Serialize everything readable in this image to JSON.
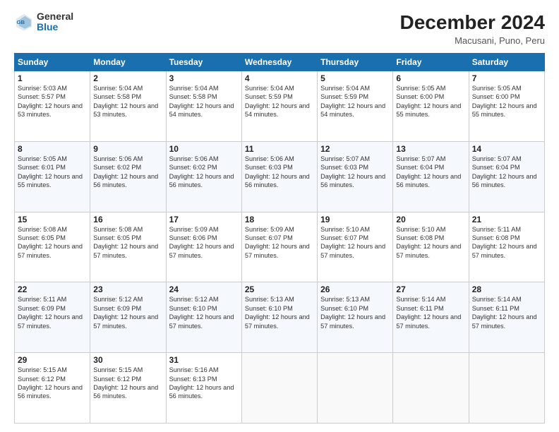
{
  "header": {
    "logo_line1": "General",
    "logo_line2": "Blue",
    "title": "December 2024",
    "subtitle": "Macusani, Puno, Peru"
  },
  "weekdays": [
    "Sunday",
    "Monday",
    "Tuesday",
    "Wednesday",
    "Thursday",
    "Friday",
    "Saturday"
  ],
  "weeks": [
    [
      {
        "day": "1",
        "rise": "5:03 AM",
        "set": "5:57 PM",
        "hours": "12 hours and 53 minutes."
      },
      {
        "day": "2",
        "rise": "5:04 AM",
        "set": "5:58 PM",
        "hours": "12 hours and 53 minutes."
      },
      {
        "day": "3",
        "rise": "5:04 AM",
        "set": "5:58 PM",
        "hours": "12 hours and 54 minutes."
      },
      {
        "day": "4",
        "rise": "5:04 AM",
        "set": "5:59 PM",
        "hours": "12 hours and 54 minutes."
      },
      {
        "day": "5",
        "rise": "5:04 AM",
        "set": "5:59 PM",
        "hours": "12 hours and 54 minutes."
      },
      {
        "day": "6",
        "rise": "5:05 AM",
        "set": "6:00 PM",
        "hours": "12 hours and 55 minutes."
      },
      {
        "day": "7",
        "rise": "5:05 AM",
        "set": "6:00 PM",
        "hours": "12 hours and 55 minutes."
      }
    ],
    [
      {
        "day": "8",
        "rise": "5:05 AM",
        "set": "6:01 PM",
        "hours": "12 hours and 55 minutes."
      },
      {
        "day": "9",
        "rise": "5:06 AM",
        "set": "6:02 PM",
        "hours": "12 hours and 56 minutes."
      },
      {
        "day": "10",
        "rise": "5:06 AM",
        "set": "6:02 PM",
        "hours": "12 hours and 56 minutes."
      },
      {
        "day": "11",
        "rise": "5:06 AM",
        "set": "6:03 PM",
        "hours": "12 hours and 56 minutes."
      },
      {
        "day": "12",
        "rise": "5:07 AM",
        "set": "6:03 PM",
        "hours": "12 hours and 56 minutes."
      },
      {
        "day": "13",
        "rise": "5:07 AM",
        "set": "6:04 PM",
        "hours": "12 hours and 56 minutes."
      },
      {
        "day": "14",
        "rise": "5:07 AM",
        "set": "6:04 PM",
        "hours": "12 hours and 56 minutes."
      }
    ],
    [
      {
        "day": "15",
        "rise": "5:08 AM",
        "set": "6:05 PM",
        "hours": "12 hours and 57 minutes."
      },
      {
        "day": "16",
        "rise": "5:08 AM",
        "set": "6:05 PM",
        "hours": "12 hours and 57 minutes."
      },
      {
        "day": "17",
        "rise": "5:09 AM",
        "set": "6:06 PM",
        "hours": "12 hours and 57 minutes."
      },
      {
        "day": "18",
        "rise": "5:09 AM",
        "set": "6:07 PM",
        "hours": "12 hours and 57 minutes."
      },
      {
        "day": "19",
        "rise": "5:10 AM",
        "set": "6:07 PM",
        "hours": "12 hours and 57 minutes."
      },
      {
        "day": "20",
        "rise": "5:10 AM",
        "set": "6:08 PM",
        "hours": "12 hours and 57 minutes."
      },
      {
        "day": "21",
        "rise": "5:11 AM",
        "set": "6:08 PM",
        "hours": "12 hours and 57 minutes."
      }
    ],
    [
      {
        "day": "22",
        "rise": "5:11 AM",
        "set": "6:09 PM",
        "hours": "12 hours and 57 minutes."
      },
      {
        "day": "23",
        "rise": "5:12 AM",
        "set": "6:09 PM",
        "hours": "12 hours and 57 minutes."
      },
      {
        "day": "24",
        "rise": "5:12 AM",
        "set": "6:10 PM",
        "hours": "12 hours and 57 minutes."
      },
      {
        "day": "25",
        "rise": "5:13 AM",
        "set": "6:10 PM",
        "hours": "12 hours and 57 minutes."
      },
      {
        "day": "26",
        "rise": "5:13 AM",
        "set": "6:10 PM",
        "hours": "12 hours and 57 minutes."
      },
      {
        "day": "27",
        "rise": "5:14 AM",
        "set": "6:11 PM",
        "hours": "12 hours and 57 minutes."
      },
      {
        "day": "28",
        "rise": "5:14 AM",
        "set": "6:11 PM",
        "hours": "12 hours and 57 minutes."
      }
    ],
    [
      {
        "day": "29",
        "rise": "5:15 AM",
        "set": "6:12 PM",
        "hours": "12 hours and 56 minutes."
      },
      {
        "day": "30",
        "rise": "5:15 AM",
        "set": "6:12 PM",
        "hours": "12 hours and 56 minutes."
      },
      {
        "day": "31",
        "rise": "5:16 AM",
        "set": "6:13 PM",
        "hours": "12 hours and 56 minutes."
      },
      null,
      null,
      null,
      null
    ]
  ]
}
